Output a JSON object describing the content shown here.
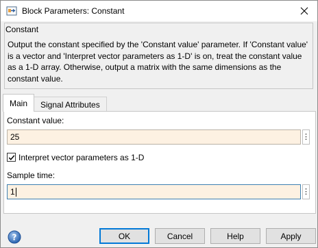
{
  "window": {
    "title": "Block Parameters: Constant"
  },
  "group": {
    "label": "Constant",
    "description": "Output the constant specified by the 'Constant value' parameter. If 'Constant value' is a vector and 'Interpret vector parameters as 1-D' is on, treat the constant value as a 1-D array. Otherwise, output a matrix with the same dimensions as the constant value."
  },
  "tabs": [
    {
      "label": "Main",
      "active": true
    },
    {
      "label": "Signal Attributes",
      "active": false
    }
  ],
  "main": {
    "constant_value_label": "Constant value:",
    "constant_value": "25",
    "interpret_checkbox_label": "Interpret vector parameters as 1-D",
    "interpret_checked": true,
    "sample_time_label": "Sample time:",
    "sample_time": "1",
    "more_glyph": "⋮"
  },
  "footer": {
    "ok": "OK",
    "cancel": "Cancel",
    "help": "Help",
    "apply": "Apply"
  },
  "icons": {
    "app": "simulink-block-icon",
    "close": "close-icon",
    "help": "help-question-icon",
    "check": "checkmark-icon"
  },
  "colors": {
    "input_bg": "#fdf1e2",
    "focus_border": "#3c7fb1",
    "default_button_border": "#0078d7"
  }
}
